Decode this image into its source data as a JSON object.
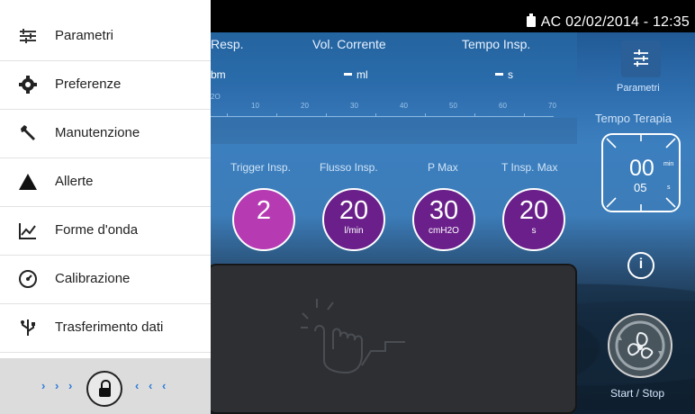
{
  "status": {
    "mode": "AC",
    "datetime": "02/02/2014 - 12:35"
  },
  "params_panel": {
    "headers": [
      "Resp.",
      "Vol. Corrente",
      "Tempo Insp."
    ],
    "values": [
      {
        "dash": "",
        "unit": "bm"
      },
      {
        "dash": "-",
        "unit": "ml"
      },
      {
        "dash": "-",
        "unit": "s"
      }
    ]
  },
  "pressure_scale": {
    "unit_fragment": "2O",
    "ticks": [
      "10",
      "20",
      "30",
      "40",
      "50",
      "60",
      "70"
    ]
  },
  "settings": [
    {
      "label": "Trigger Insp.",
      "value": "2",
      "unit": "",
      "color": "#b63bb3"
    },
    {
      "label": "Flusso Insp.",
      "value": "20",
      "unit": "l/min",
      "color": "#6a1f8a"
    },
    {
      "label": "P Max",
      "value": "30",
      "unit": "cmH2O",
      "color": "#6a1f8a"
    },
    {
      "label": "T Insp. Max",
      "value": "20",
      "unit": "s",
      "color": "#6a1f8a"
    }
  ],
  "right_panel": {
    "parametri_label": "Parametri",
    "tempo_terapia_label": "Tempo Terapia",
    "timer": {
      "minutes": "00",
      "minutes_unit": "min",
      "seconds": "05",
      "seconds_unit": "s"
    },
    "info_icon": "info-icon",
    "start_stop_label": "Start / Stop"
  },
  "menu": {
    "items": [
      {
        "label": "Parametri",
        "icon": "sliders-icon"
      },
      {
        "label": "Preferenze",
        "icon": "gear-icon"
      },
      {
        "label": "Manutenzione",
        "icon": "wrench-icon"
      },
      {
        "label": "Allerte",
        "icon": "warning-icon"
      },
      {
        "label": "Forme d'onda",
        "icon": "chart-icon"
      },
      {
        "label": "Calibrazione",
        "icon": "gauge-icon"
      },
      {
        "label": "Trasferimento dati",
        "icon": "usb-icon"
      }
    ],
    "lock_icon": "lock-icon"
  },
  "colors": {
    "accent_blue": "#2d7bd8",
    "purple": "#6a1f8a",
    "magenta": "#b63bb3"
  }
}
